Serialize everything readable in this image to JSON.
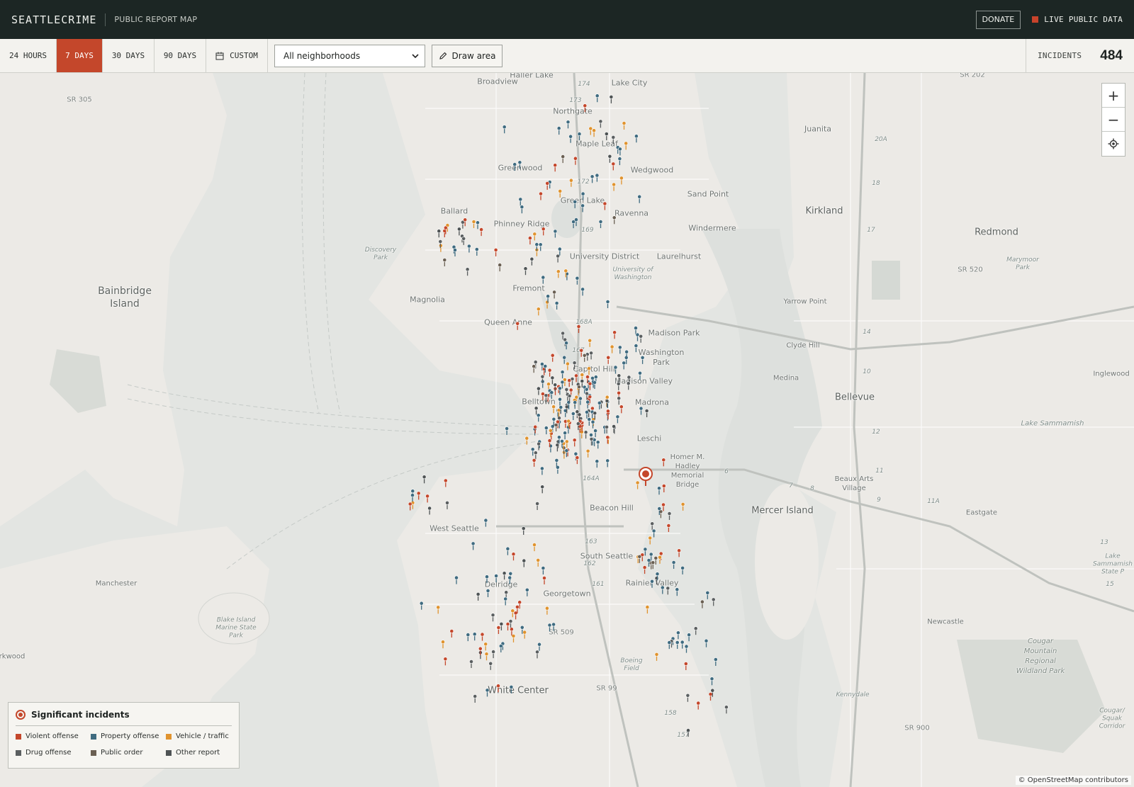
{
  "header": {
    "brand": "SEATTLECRIME",
    "subtitle": "PUBLIC REPORT MAP",
    "donate_label": "DONATE",
    "live_label": "LIVE PUBLIC DATA",
    "live_color": "#c8432b"
  },
  "filters": {
    "ranges": [
      {
        "label": "24 HOURS",
        "active": false
      },
      {
        "label": "7 DAYS",
        "active": true
      },
      {
        "label": "30 DAYS",
        "active": false
      },
      {
        "label": "90 DAYS",
        "active": false
      }
    ],
    "custom_label": "CUSTOM",
    "custom_icon": "calendar-icon",
    "neighborhood_value": "All neighborhoods",
    "draw_label": "Draw area",
    "draw_icon": "pencil-icon",
    "incidents_label": "INCIDENTS",
    "incidents_count": "484",
    "accent": "#c4472b"
  },
  "map_labels": [
    "Haller Lake",
    "Broadview",
    "Lake City",
    "Northgate",
    "Maple Leaf",
    "Greenwood",
    "Wedgwood",
    "Sand Point",
    "Green Lake",
    "Ballard",
    "Phinney Ridge",
    "Ravenna",
    "Windermere",
    "Laurelhurst",
    "University District",
    "University of Washington",
    "Discovery Park",
    "Fremont",
    "Magnolia",
    "Queen Anne",
    "Madison Park",
    "Washington Park",
    "Capitol Hill",
    "Madison Valley",
    "Belltown",
    "Madrona",
    "Leschi",
    "Homer M. Hadley Memorial Bridge",
    "West Seattle",
    "Beacon Hill",
    "South Seattle",
    "Delridge",
    "Georgetown",
    "Rainier Valley",
    "White Center",
    "Boeing Field",
    "Bainbridge Island",
    "Manchester",
    "Blake Island Marine State Park",
    "rkwood",
    "Juanita",
    "Kirkland",
    "Redmond",
    "Marymoor Park",
    "Yarrow Point",
    "Clyde Hill",
    "Medina",
    "Bellevue",
    "Inglewood",
    "Lake Sammamish",
    "Beaux Arts Village",
    "Mercer Island",
    "Eastgate",
    "Lake Sammamish State P",
    "Newcastle",
    "Cougar Mountain Regional Wildland Park",
    "Kennydale",
    "Cougar/ Squak Corridor",
    "SR 305",
    "SR 202",
    "SR 520",
    "SR 509",
    "SR 99",
    "SR 900"
  ],
  "map_numbers": [
    "174",
    "173",
    "172",
    "169",
    "168A",
    "167",
    "164A",
    "163",
    "162",
    "161",
    "158",
    "157",
    "20A",
    "18",
    "17",
    "14",
    "12",
    "11",
    "13",
    "15",
    "9",
    "8",
    "7",
    "6",
    "10",
    "11A"
  ],
  "zoom": {
    "in": "+",
    "out": "−",
    "locate_icon": "locate-icon"
  },
  "legend": {
    "title": "Significant incidents",
    "items": [
      {
        "label": "Violent offense",
        "color": "#c4472b"
      },
      {
        "label": "Property offense",
        "color": "#3f6b80"
      },
      {
        "label": "Vehicle / traffic",
        "color": "#e0932e"
      },
      {
        "label": "Drug offense",
        "color": "#5b5f60"
      },
      {
        "label": "Public order",
        "color": "#6a5f52"
      },
      {
        "label": "Other report",
        "color": "#4e5354"
      }
    ]
  },
  "attribution": "© OpenStreetMap contributors"
}
